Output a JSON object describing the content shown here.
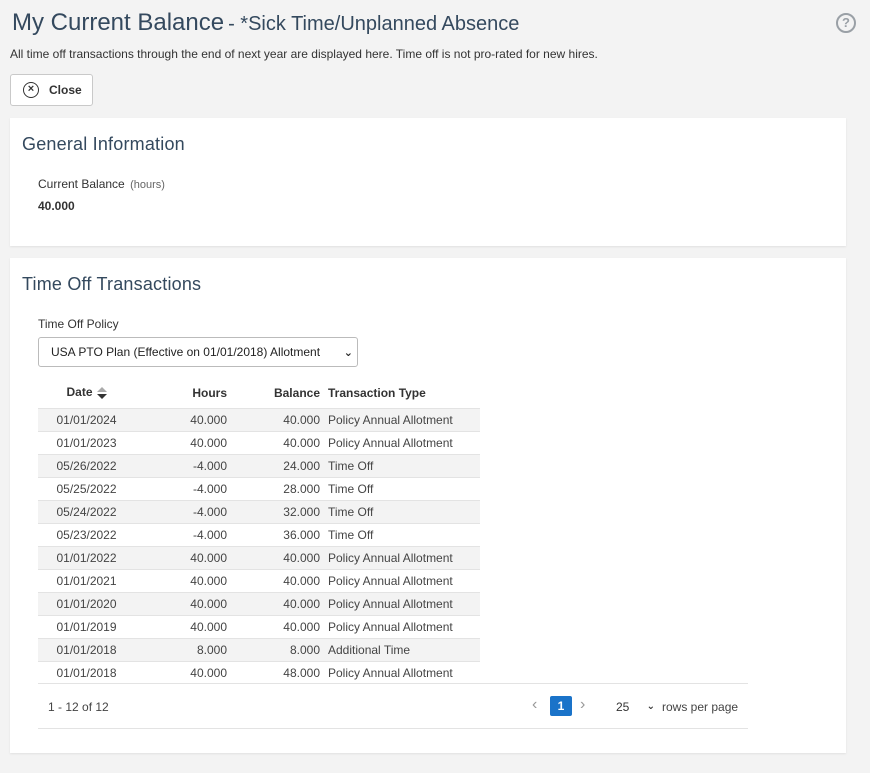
{
  "header": {
    "title": "My Current Balance",
    "subtitle": "- *Sick Time/Unplanned Absence",
    "help_icon": "question-circle-icon",
    "intro": "All time off transactions through the end of next year are displayed here. Time off is not pro-rated for new hires."
  },
  "toolbar": {
    "close_label": "Close",
    "close_icon": "close-circle-icon"
  },
  "general": {
    "heading": "General Information",
    "balance_label": "Current Balance",
    "balance_unit": "(hours)",
    "balance_value": "40.000"
  },
  "transactions": {
    "heading": "Time Off Transactions",
    "policy_label": "Time Off Policy",
    "policy_value": "USA PTO Plan (Effective on 01/01/2018) Allotment",
    "columns": [
      "Date",
      "Hours",
      "Balance",
      "Transaction Type"
    ],
    "rows": [
      {
        "date": "01/01/2024",
        "hours": "40.000",
        "balance": "40.000",
        "type": "Policy Annual Allotment"
      },
      {
        "date": "01/01/2023",
        "hours": "40.000",
        "balance": "40.000",
        "type": "Policy Annual Allotment"
      },
      {
        "date": "05/26/2022",
        "hours": "-4.000",
        "balance": "24.000",
        "type": "Time Off"
      },
      {
        "date": "05/25/2022",
        "hours": "-4.000",
        "balance": "28.000",
        "type": "Time Off"
      },
      {
        "date": "05/24/2022",
        "hours": "-4.000",
        "balance": "32.000",
        "type": "Time Off"
      },
      {
        "date": "05/23/2022",
        "hours": "-4.000",
        "balance": "36.000",
        "type": "Time Off"
      },
      {
        "date": "01/01/2022",
        "hours": "40.000",
        "balance": "40.000",
        "type": "Policy Annual Allotment"
      },
      {
        "date": "01/01/2021",
        "hours": "40.000",
        "balance": "40.000",
        "type": "Policy Annual Allotment"
      },
      {
        "date": "01/01/2020",
        "hours": "40.000",
        "balance": "40.000",
        "type": "Policy Annual Allotment"
      },
      {
        "date": "01/01/2019",
        "hours": "40.000",
        "balance": "40.000",
        "type": "Policy Annual Allotment"
      },
      {
        "date": "01/01/2018",
        "hours": "8.000",
        "balance": "8.000",
        "type": "Additional Time"
      },
      {
        "date": "01/01/2018",
        "hours": "40.000",
        "balance": "48.000",
        "type": "Policy Annual Allotment"
      }
    ]
  },
  "pager": {
    "count": "1 - 12 of 12",
    "current_page": "1",
    "rows_per_page_value": "25",
    "rows_per_page_label": "rows per page"
  },
  "colors": {
    "accent": "#1a73c9",
    "heading": "#34495e",
    "row_alt": "#f3f3f3"
  }
}
